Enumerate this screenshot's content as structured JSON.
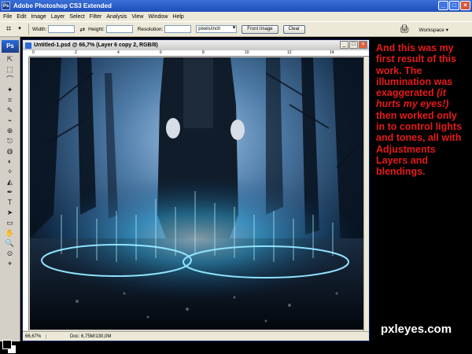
{
  "app": {
    "badge": "Ps",
    "title": "Adobe Photoshop CS3 Extended",
    "window_buttons": [
      "_",
      "□",
      "×"
    ]
  },
  "menu": [
    "File",
    "Edit",
    "Image",
    "Layer",
    "Select",
    "Filter",
    "Analysis",
    "View",
    "Window",
    "Help"
  ],
  "options": {
    "tool_icon": "crop-icon",
    "width_label": "Width:",
    "width_value": "",
    "height_label": "Height:",
    "height_value": "",
    "resolution_label": "Resolution:",
    "resolution_value": "",
    "resolution_unit": "pixels/inch",
    "front_image_label": "Front Image",
    "clear_label": "Clear",
    "workspace_label": "Workspace ▾"
  },
  "toolbox": {
    "logo": "Ps",
    "tools": [
      "⇱",
      "⬚",
      "⌒",
      "✦",
      "⌗",
      "✎",
      "⌁",
      "⊕",
      "⎋",
      "◍",
      "◐",
      "✧",
      "◭",
      "✒",
      "T",
      "➤",
      "▭",
      "✋",
      "🔍",
      "⊙",
      "⌖"
    ]
  },
  "document": {
    "title": "Untitled-1.psd @ 66,7% (Layer 6 copy 2, RGB/8)",
    "ruler_labels": [
      "0",
      "2",
      "4",
      "6",
      "8",
      "10",
      "12",
      "14"
    ],
    "zoom": "66,67%",
    "doc_info": "Doc: 6,75M/130,0M"
  },
  "caption": {
    "line1": "And this was my first result of this work. The illumination was exaggerated",
    "italic": "(it hurts my eyes!)",
    "line2": "then worked only in to control lights and tones, all with Adjustments Layers and blendings."
  },
  "watermark": "pxleyes.com",
  "colors": {
    "caption_red": "#e61a1a",
    "title_blue": "#1f4fb8",
    "glow_cyan": "#38c6ff"
  }
}
